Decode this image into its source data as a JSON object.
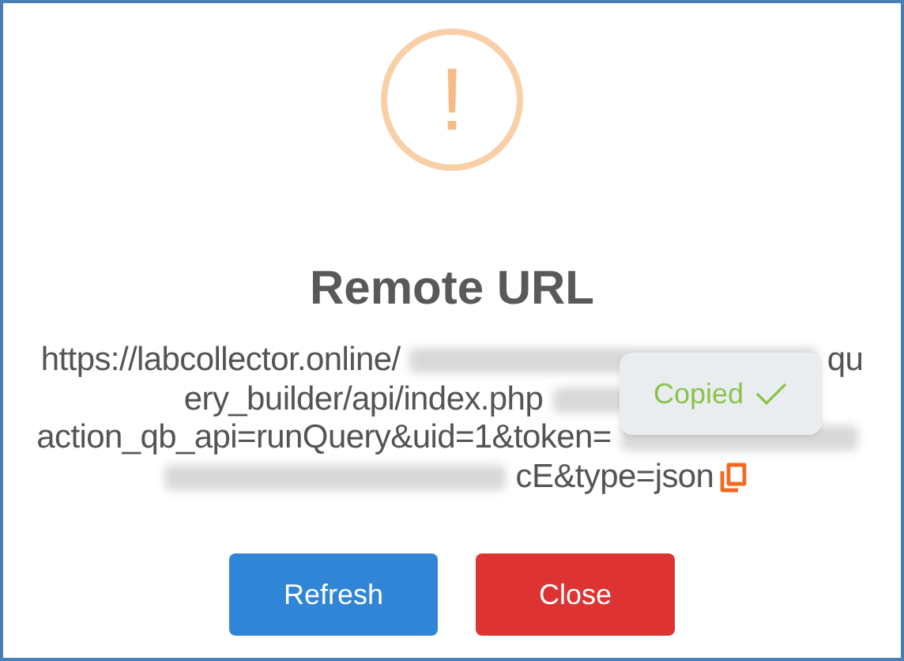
{
  "icon": {
    "symbol": "!"
  },
  "title": "Remote URL",
  "url_lines": [
    {
      "parts": [
        {
          "kind": "text",
          "text": "https://labcollector.online/"
        },
        {
          "kind": "redacted"
        },
        {
          "kind": "text",
          "text": "qu"
        }
      ]
    },
    {
      "parts": [
        {
          "kind": "text",
          "text": "ery_builder/api/index.php"
        },
        {
          "kind": "redacted"
        }
      ]
    },
    {
      "parts": [
        {
          "kind": "text",
          "text": "action_qb_api=runQuery&uid=1&token="
        },
        {
          "kind": "redacted"
        }
      ]
    },
    {
      "parts": [
        {
          "kind": "redacted"
        },
        {
          "kind": "text",
          "text": "cE&type=json"
        },
        {
          "kind": "copy"
        }
      ]
    }
  ],
  "tooltip": {
    "text": "Copied",
    "checked": true
  },
  "buttons": [
    {
      "label": "Refresh",
      "kind": "confirm"
    },
    {
      "label": "Close",
      "kind": "cancel"
    }
  ]
}
